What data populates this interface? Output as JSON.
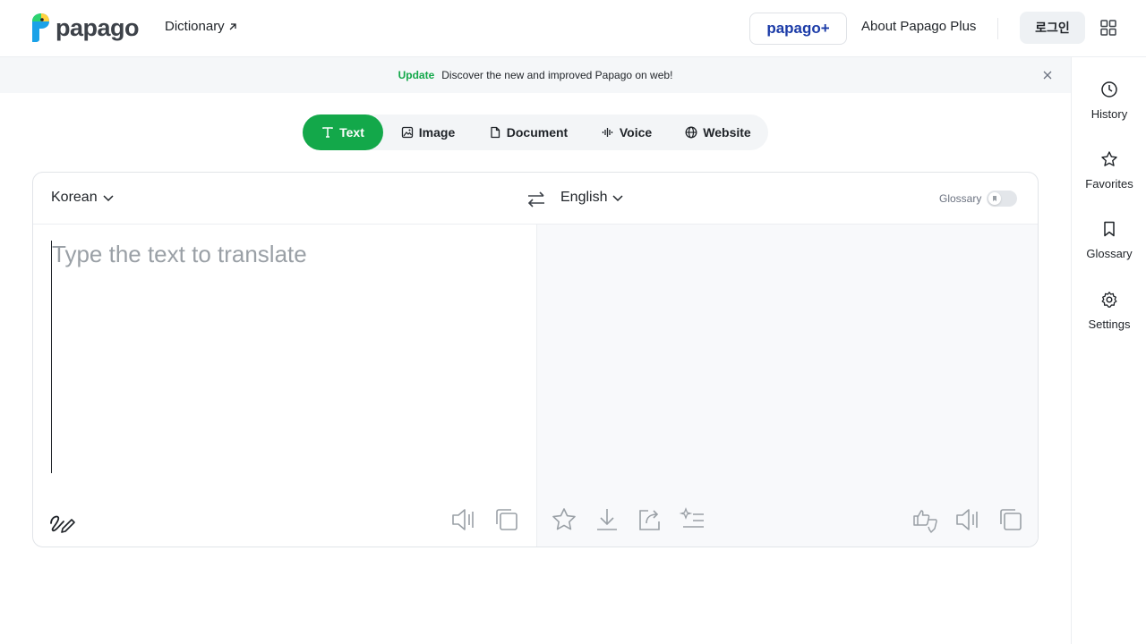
{
  "header": {
    "logo_text": "papago",
    "dictionary_label": "Dictionary",
    "plus_label": "papago+",
    "about_label": "About Papago Plus",
    "login_label": "로그인"
  },
  "banner": {
    "tag": "Update",
    "text": "Discover the new and improved Papago on web!"
  },
  "sidebar": {
    "items": [
      {
        "label": "History",
        "icon": "clock-icon"
      },
      {
        "label": "Favorites",
        "icon": "star-icon"
      },
      {
        "label": "Glossary",
        "icon": "bookmark-icon"
      },
      {
        "label": "Settings",
        "icon": "gear-icon"
      }
    ]
  },
  "tabs": [
    {
      "label": "Text",
      "icon": "text-icon",
      "active": true
    },
    {
      "label": "Image",
      "icon": "image-icon",
      "active": false
    },
    {
      "label": "Document",
      "icon": "document-icon",
      "active": false
    },
    {
      "label": "Voice",
      "icon": "voice-icon",
      "active": false
    },
    {
      "label": "Website",
      "icon": "globe-icon",
      "active": false
    }
  ],
  "translator": {
    "source_language": "Korean",
    "target_language": "English",
    "glossary_label": "Glossary",
    "glossary_enabled": false,
    "source_value": "",
    "source_placeholder": "Type the text to translate"
  },
  "colors": {
    "accent": "#13a84a",
    "plus_brand": "#1c3ca8"
  }
}
